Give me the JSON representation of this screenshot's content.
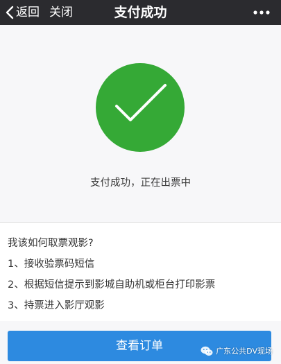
{
  "navbar": {
    "back_label": "返回",
    "close_label": "关闭",
    "title": "支付成功"
  },
  "status": {
    "message": "支付成功，正在出票中",
    "icon": "check-circle-icon",
    "accent_color": "#35a936"
  },
  "instructions": {
    "heading": "我该如何取票观影?",
    "steps": [
      "1、接收验票码短信",
      "2、根据短信提示到影城自助机或柜台打印影票",
      "3、持票进入影厅观影"
    ]
  },
  "actions": {
    "view_order_label": "查看订单",
    "button_color": "#2d8ae0"
  },
  "watermark": {
    "text": "广东公共DV现场"
  }
}
